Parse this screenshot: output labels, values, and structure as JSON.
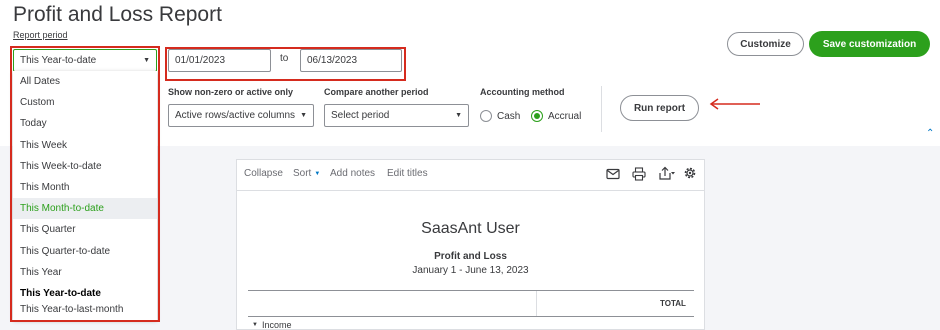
{
  "page": {
    "title": "Profit and Loss Report"
  },
  "report_period": {
    "label": "Report period",
    "selected": "This Year-to-date",
    "from_date": "01/01/2023",
    "to_label": "to",
    "to_date": "06/13/2023",
    "options": [
      "All Dates",
      "Custom",
      "Today",
      "This Week",
      "This Week-to-date",
      "This Month",
      "This Month-to-date",
      "This Quarter",
      "This Quarter-to-date",
      "This Year",
      "This Year-to-date",
      "This Year-to-last-month"
    ]
  },
  "filters": {
    "nonzero_label": "Show non-zero or active only",
    "nonzero_value": "Active rows/active columns",
    "compare_label": "Compare another period",
    "compare_value": "Select period",
    "accounting_label": "Accounting method",
    "cash_label": "Cash",
    "accrual_label": "Accrual",
    "selected_method": "Accrual"
  },
  "actions": {
    "customize": "Customize",
    "save_customization": "Save customization",
    "run_report": "Run report"
  },
  "report_toolbar": {
    "collapse": "Collapse",
    "sort": "Sort",
    "add_notes": "Add notes",
    "edit_titles": "Edit titles"
  },
  "report": {
    "company": "SaasAnt User",
    "title": "Profit and Loss",
    "date_range": "January 1 - June 13, 2023",
    "total_header": "TOTAL",
    "first_row": "Income"
  },
  "colors": {
    "accent_green": "#2ca01c",
    "annotation_red": "#d52b1e"
  }
}
